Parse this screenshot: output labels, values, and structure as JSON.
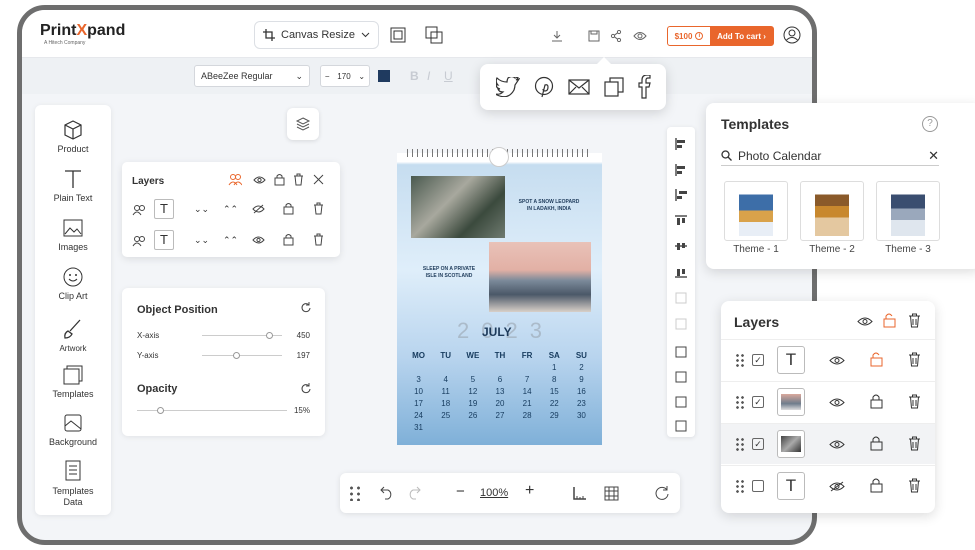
{
  "brand": {
    "logo_pre": "Print",
    "logo_x": "X",
    "logo_post": "pand",
    "logo_sub": "A Hitech Company"
  },
  "topbar": {
    "canvas_resize": "Canvas Resize",
    "price": "$100",
    "add_to_cart": "Add To cart"
  },
  "text_toolbar": {
    "font": "ABeeZee Regular",
    "size": "170",
    "color": "#1f3a5f"
  },
  "sidebar": {
    "items": [
      {
        "label": "Product",
        "icon": "cube-icon"
      },
      {
        "label": "Plain Text",
        "icon": "text-icon"
      },
      {
        "label": "Images",
        "icon": "image-icon"
      },
      {
        "label": "Clip Art",
        "icon": "smiley-icon"
      },
      {
        "label": "Artwork",
        "icon": "brush-icon"
      },
      {
        "label": "Templates",
        "icon": "templates-icon"
      },
      {
        "label": "Background",
        "icon": "background-icon"
      },
      {
        "label": "Templates\nData",
        "icon": "templates-data-icon"
      }
    ]
  },
  "layers_mini": {
    "title": "Layers"
  },
  "object_position": {
    "title": "Object Position",
    "x_label": "X-axis",
    "x_value": "450",
    "y_label": "Y-axis",
    "y_value": "197",
    "opacity_title": "Opacity",
    "opacity_value": "15%",
    "opacity_level": 0.15
  },
  "calendar": {
    "caption1": "SPOT A SNOW LEOPARD\nIN LADAKH, INDIA",
    "caption2": "SLEEP ON A PRIVATE\nISLE IN SCOTLAND",
    "year": "2023",
    "month": "JULY",
    "weekdays": [
      "MO",
      "TU",
      "WE",
      "TH",
      "FR",
      "SA",
      "SU"
    ],
    "days": [
      "1",
      "2",
      "3",
      "4",
      "5",
      "6",
      "7",
      "8",
      "9",
      "10",
      "11",
      "12",
      "13",
      "14",
      "15",
      "16",
      "17",
      "18",
      "19",
      "20",
      "21",
      "22",
      "23",
      "24",
      "25",
      "26",
      "27",
      "28",
      "29",
      "30",
      "31"
    ]
  },
  "bottombar": {
    "zoom": "100%"
  },
  "templates": {
    "title": "Templates",
    "search_value": "Photo Calendar",
    "items": [
      {
        "label": "Theme - 1"
      },
      {
        "label": "Theme - 2"
      },
      {
        "label": "Theme - 3"
      }
    ]
  },
  "layers_panel": {
    "title": "Layers"
  },
  "colors": {
    "accent": "#e9662c",
    "text_dark": "#1d3a5a"
  }
}
